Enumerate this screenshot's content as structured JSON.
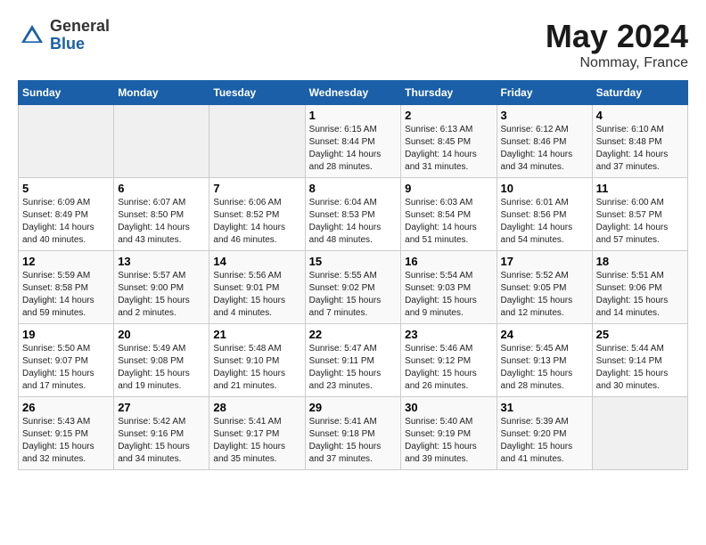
{
  "header": {
    "logo_general": "General",
    "logo_blue": "Blue",
    "month_title": "May 2024",
    "location": "Nommay, France"
  },
  "weekdays": [
    "Sunday",
    "Monday",
    "Tuesday",
    "Wednesday",
    "Thursday",
    "Friday",
    "Saturday"
  ],
  "weeks": [
    [
      {
        "day": "",
        "sunrise": "",
        "sunset": "",
        "daylight": "",
        "empty": true
      },
      {
        "day": "",
        "sunrise": "",
        "sunset": "",
        "daylight": "",
        "empty": true
      },
      {
        "day": "",
        "sunrise": "",
        "sunset": "",
        "daylight": "",
        "empty": true
      },
      {
        "day": "1",
        "sunrise": "Sunrise: 6:15 AM",
        "sunset": "Sunset: 8:44 PM",
        "daylight": "Daylight: 14 hours and 28 minutes."
      },
      {
        "day": "2",
        "sunrise": "Sunrise: 6:13 AM",
        "sunset": "Sunset: 8:45 PM",
        "daylight": "Daylight: 14 hours and 31 minutes."
      },
      {
        "day": "3",
        "sunrise": "Sunrise: 6:12 AM",
        "sunset": "Sunset: 8:46 PM",
        "daylight": "Daylight: 14 hours and 34 minutes."
      },
      {
        "day": "4",
        "sunrise": "Sunrise: 6:10 AM",
        "sunset": "Sunset: 8:48 PM",
        "daylight": "Daylight: 14 hours and 37 minutes."
      }
    ],
    [
      {
        "day": "5",
        "sunrise": "Sunrise: 6:09 AM",
        "sunset": "Sunset: 8:49 PM",
        "daylight": "Daylight: 14 hours and 40 minutes."
      },
      {
        "day": "6",
        "sunrise": "Sunrise: 6:07 AM",
        "sunset": "Sunset: 8:50 PM",
        "daylight": "Daylight: 14 hours and 43 minutes."
      },
      {
        "day": "7",
        "sunrise": "Sunrise: 6:06 AM",
        "sunset": "Sunset: 8:52 PM",
        "daylight": "Daylight: 14 hours and 46 minutes."
      },
      {
        "day": "8",
        "sunrise": "Sunrise: 6:04 AM",
        "sunset": "Sunset: 8:53 PM",
        "daylight": "Daylight: 14 hours and 48 minutes."
      },
      {
        "day": "9",
        "sunrise": "Sunrise: 6:03 AM",
        "sunset": "Sunset: 8:54 PM",
        "daylight": "Daylight: 14 hours and 51 minutes."
      },
      {
        "day": "10",
        "sunrise": "Sunrise: 6:01 AM",
        "sunset": "Sunset: 8:56 PM",
        "daylight": "Daylight: 14 hours and 54 minutes."
      },
      {
        "day": "11",
        "sunrise": "Sunrise: 6:00 AM",
        "sunset": "Sunset: 8:57 PM",
        "daylight": "Daylight: 14 hours and 57 minutes."
      }
    ],
    [
      {
        "day": "12",
        "sunrise": "Sunrise: 5:59 AM",
        "sunset": "Sunset: 8:58 PM",
        "daylight": "Daylight: 14 hours and 59 minutes."
      },
      {
        "day": "13",
        "sunrise": "Sunrise: 5:57 AM",
        "sunset": "Sunset: 9:00 PM",
        "daylight": "Daylight: 15 hours and 2 minutes."
      },
      {
        "day": "14",
        "sunrise": "Sunrise: 5:56 AM",
        "sunset": "Sunset: 9:01 PM",
        "daylight": "Daylight: 15 hours and 4 minutes."
      },
      {
        "day": "15",
        "sunrise": "Sunrise: 5:55 AM",
        "sunset": "Sunset: 9:02 PM",
        "daylight": "Daylight: 15 hours and 7 minutes."
      },
      {
        "day": "16",
        "sunrise": "Sunrise: 5:54 AM",
        "sunset": "Sunset: 9:03 PM",
        "daylight": "Daylight: 15 hours and 9 minutes."
      },
      {
        "day": "17",
        "sunrise": "Sunrise: 5:52 AM",
        "sunset": "Sunset: 9:05 PM",
        "daylight": "Daylight: 15 hours and 12 minutes."
      },
      {
        "day": "18",
        "sunrise": "Sunrise: 5:51 AM",
        "sunset": "Sunset: 9:06 PM",
        "daylight": "Daylight: 15 hours and 14 minutes."
      }
    ],
    [
      {
        "day": "19",
        "sunrise": "Sunrise: 5:50 AM",
        "sunset": "Sunset: 9:07 PM",
        "daylight": "Daylight: 15 hours and 17 minutes."
      },
      {
        "day": "20",
        "sunrise": "Sunrise: 5:49 AM",
        "sunset": "Sunset: 9:08 PM",
        "daylight": "Daylight: 15 hours and 19 minutes."
      },
      {
        "day": "21",
        "sunrise": "Sunrise: 5:48 AM",
        "sunset": "Sunset: 9:10 PM",
        "daylight": "Daylight: 15 hours and 21 minutes."
      },
      {
        "day": "22",
        "sunrise": "Sunrise: 5:47 AM",
        "sunset": "Sunset: 9:11 PM",
        "daylight": "Daylight: 15 hours and 23 minutes."
      },
      {
        "day": "23",
        "sunrise": "Sunrise: 5:46 AM",
        "sunset": "Sunset: 9:12 PM",
        "daylight": "Daylight: 15 hours and 26 minutes."
      },
      {
        "day": "24",
        "sunrise": "Sunrise: 5:45 AM",
        "sunset": "Sunset: 9:13 PM",
        "daylight": "Daylight: 15 hours and 28 minutes."
      },
      {
        "day": "25",
        "sunrise": "Sunrise: 5:44 AM",
        "sunset": "Sunset: 9:14 PM",
        "daylight": "Daylight: 15 hours and 30 minutes."
      }
    ],
    [
      {
        "day": "26",
        "sunrise": "Sunrise: 5:43 AM",
        "sunset": "Sunset: 9:15 PM",
        "daylight": "Daylight: 15 hours and 32 minutes."
      },
      {
        "day": "27",
        "sunrise": "Sunrise: 5:42 AM",
        "sunset": "Sunset: 9:16 PM",
        "daylight": "Daylight: 15 hours and 34 minutes."
      },
      {
        "day": "28",
        "sunrise": "Sunrise: 5:41 AM",
        "sunset": "Sunset: 9:17 PM",
        "daylight": "Daylight: 15 hours and 35 minutes."
      },
      {
        "day": "29",
        "sunrise": "Sunrise: 5:41 AM",
        "sunset": "Sunset: 9:18 PM",
        "daylight": "Daylight: 15 hours and 37 minutes."
      },
      {
        "day": "30",
        "sunrise": "Sunrise: 5:40 AM",
        "sunset": "Sunset: 9:19 PM",
        "daylight": "Daylight: 15 hours and 39 minutes."
      },
      {
        "day": "31",
        "sunrise": "Sunrise: 5:39 AM",
        "sunset": "Sunset: 9:20 PM",
        "daylight": "Daylight: 15 hours and 41 minutes."
      },
      {
        "day": "",
        "sunrise": "",
        "sunset": "",
        "daylight": "",
        "empty": true
      }
    ]
  ]
}
